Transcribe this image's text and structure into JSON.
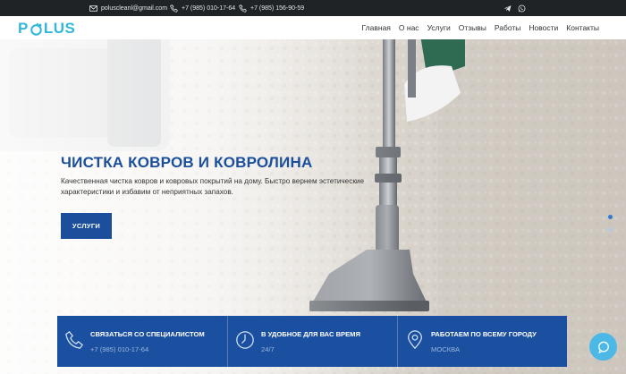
{
  "topbar": {
    "email": "poluscleanl@gmail.com",
    "phone1": "+7 (985) 010-17-64",
    "phone2": "+7 (985) 156-90-59",
    "icons": [
      "email-icon",
      "phone-icon",
      "phone-icon",
      "telegram-icon",
      "whatsapp-icon"
    ]
  },
  "header": {
    "logo": {
      "p": "P",
      "rest": "LUS"
    },
    "nav": [
      "Главная",
      "О нас",
      "Услуги",
      "Отзывы",
      "Работы",
      "Новости",
      "Контакты"
    ]
  },
  "hero": {
    "title": "ЧИСТКА КОВРОВ И КОВРОЛИНА",
    "text": "Качественная чистка ковров и ковровых покрытий на дому. Быстро вернем эстетические характеристики и избавим от неприятных запахов.",
    "button": "УСЛУГИ",
    "slides": 2,
    "active_slide": 1
  },
  "features": [
    {
      "icon": "phone-icon",
      "title": "СВЯЗАТЬСЯ СО СПЕЦИАЛИСТОМ",
      "subtitle": "+7 (985) 010-17-64"
    },
    {
      "icon": "clock-icon",
      "title": "В УДОБНОЕ ДЛЯ ВАС ВРЕМЯ",
      "subtitle": "24/7"
    },
    {
      "icon": "location-pin-icon",
      "title": "РАБОТАЕМ ПО ВСЕМУ ГОРОДУ",
      "subtitle": "МОСКВА"
    }
  ],
  "colors": {
    "brand_blue": "#1b4f9c",
    "logo_cyan": "#33b7d9",
    "topbar": "#1f2326",
    "chat": "#4cb8e6"
  }
}
